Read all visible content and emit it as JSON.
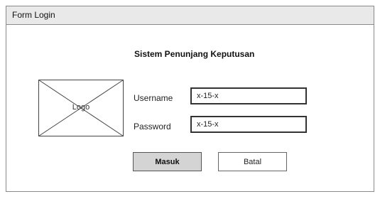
{
  "window": {
    "title": "Form Login"
  },
  "header": {
    "app_title": "Sistem Penunjang Keputusan"
  },
  "logo": {
    "label": "Logo"
  },
  "form": {
    "username_label": "Username",
    "username_value": "x-15-x",
    "password_label": "Password",
    "password_value": "x-15-x"
  },
  "actions": {
    "submit_label": "Masuk",
    "cancel_label": "Batal"
  }
}
